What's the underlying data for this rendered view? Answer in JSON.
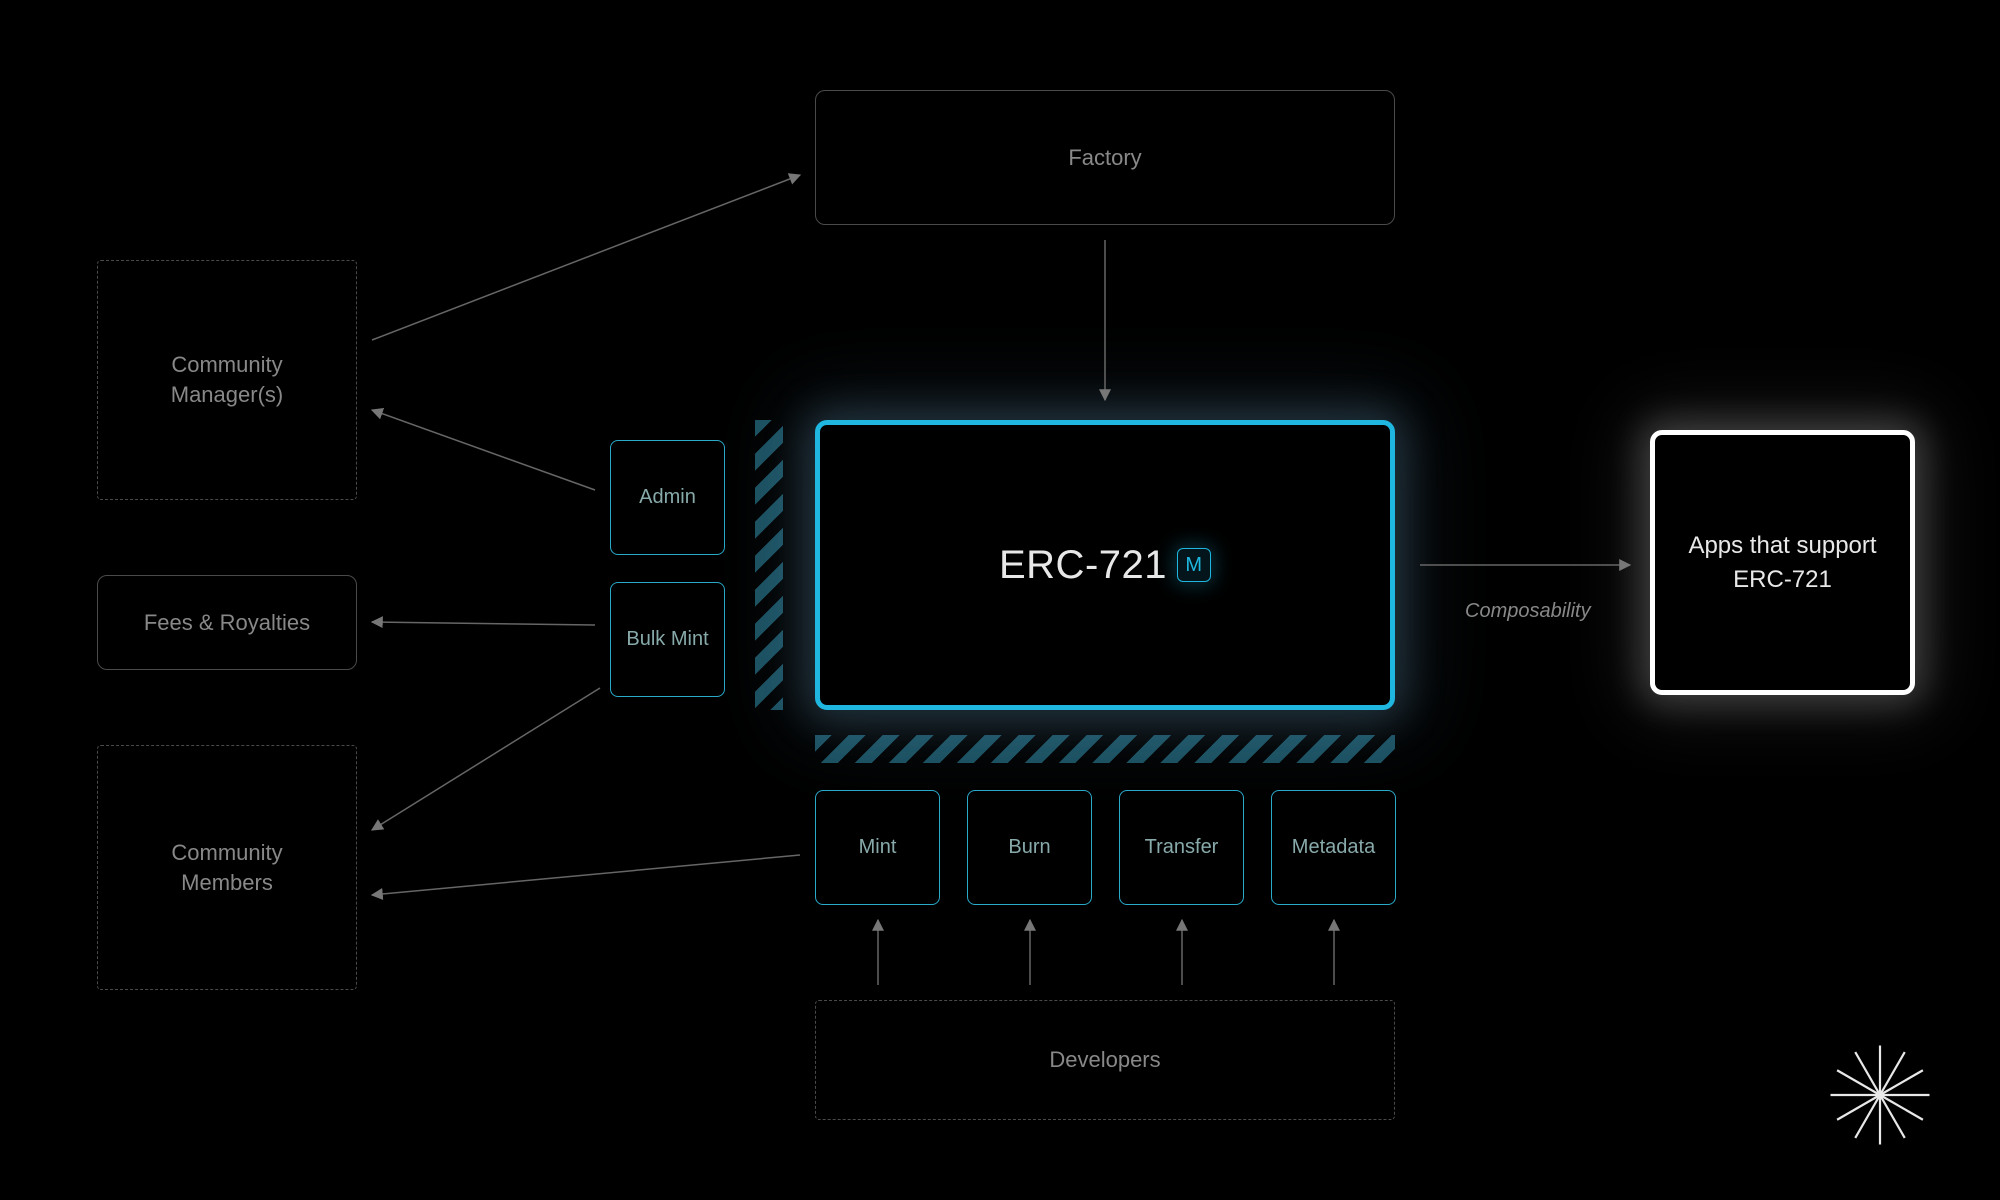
{
  "nodes": {
    "factory": "Factory",
    "community_managers": "Community\nManager(s)",
    "fees_royalties": "Fees & Royalties",
    "community_members": "Community\nMembers",
    "admin": "Admin",
    "bulk_mint": "Bulk Mint",
    "erc721": "ERC-721",
    "erc721_badge": "M",
    "mint": "Mint",
    "burn": "Burn",
    "transfer": "Transfer",
    "metadata": "Metadata",
    "developers": "Developers",
    "apps": "Apps that support ERC-721"
  },
  "labels": {
    "composability": "Composability"
  },
  "colors": {
    "bg": "#000000",
    "gray_border": "#4a4a4a",
    "text_muted": "#888888",
    "teal": "#1fb6e0",
    "teal_border": "#2aa9c9",
    "white": "#ffffff"
  }
}
